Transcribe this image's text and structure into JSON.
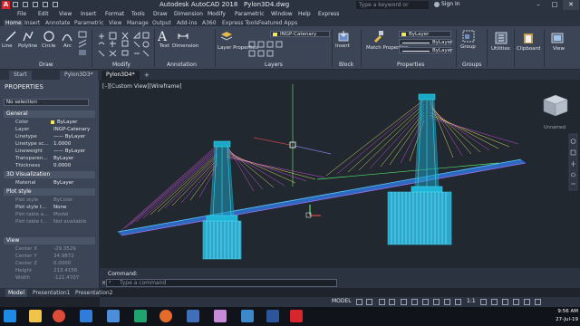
{
  "window": {
    "app_title": "Autodesk AutoCAD 2018",
    "file_name": "Pylon3D4.dwg",
    "search_placeholder": "Type a keyword or phrase",
    "sign_in": "Sign In",
    "minimize": "–",
    "maximize": "□",
    "close": "✕"
  },
  "menu": [
    "File",
    "Edit",
    "View",
    "Insert",
    "Format",
    "Tools",
    "Draw",
    "Dimension",
    "Modify",
    "Parametric",
    "Window",
    "Help",
    "Express"
  ],
  "ribbon_tabs": [
    "Home",
    "Insert",
    "Annotate",
    "Parametric",
    "View",
    "Manage",
    "Output",
    "Add-ins",
    "A360",
    "Express Tools",
    "Featured Apps"
  ],
  "ribbon": {
    "draw": {
      "line": "Line",
      "polyline": "Polyline",
      "circle": "Circle",
      "arc": "Arc",
      "panel": "Draw"
    },
    "modify": {
      "panel": "Modify"
    },
    "annotation": {
      "text": "Text",
      "dimension": "Dimension",
      "panel": "Annotation"
    },
    "layers": {
      "layer_properties": "Layer Properties",
      "current_layer": "INGP-Catenary",
      "panel": "Layers"
    },
    "block": {
      "insert": "Insert",
      "panel": "Block"
    },
    "properties": {
      "match": "Match Properties",
      "color": "ByLayer",
      "linetype": "ByLayer",
      "lineweight": "ByLayer",
      "panel": "Properties"
    },
    "groups": {
      "group": "Group",
      "panel": "Groups"
    },
    "utilities": "Utilities",
    "clipboard": "Clipboard",
    "view": "View"
  },
  "doc_tabs": [
    "Start",
    "Pylon3D3*",
    "Pylon3D4*"
  ],
  "viewport_label": "[–][Custom View][Wireframe]",
  "viewcube_label": "Unnamed",
  "properties": {
    "title": "PROPERTIES",
    "selection": "No selection",
    "general": {
      "title": "General",
      "rows": [
        {
          "k": "Color",
          "v": "ByLayer"
        },
        {
          "k": "Layer",
          "v": "INGP-Catenary"
        },
        {
          "k": "Linetype",
          "v": "—— ByLayer"
        },
        {
          "k": "Linetype sc...",
          "v": "1.0000"
        },
        {
          "k": "Lineweight",
          "v": "—— ByLayer"
        },
        {
          "k": "Transparen...",
          "v": "ByLayer"
        },
        {
          "k": "Thickness",
          "v": "0.0000"
        }
      ]
    },
    "viz": {
      "title": "3D Visualization",
      "rows": [
        {
          "k": "Material",
          "v": "ByLayer"
        }
      ]
    },
    "plot": {
      "title": "Plot style",
      "rows": [
        {
          "k": "Plot style",
          "v": "ByColor"
        },
        {
          "k": "Plot style t...",
          "v": "None"
        },
        {
          "k": "Plot table a...",
          "v": "Model"
        },
        {
          "k": "Plot table t...",
          "v": "Not available"
        }
      ]
    },
    "view": {
      "title": "View",
      "rows": [
        {
          "k": "Center X",
          "v": "-29.3529"
        },
        {
          "k": "Center Y",
          "v": "34.9872"
        },
        {
          "k": "Center Z",
          "v": "0.0000"
        },
        {
          "k": "Height",
          "v": "213.4156"
        },
        {
          "k": "Width",
          "v": "-121.4707"
        }
      ]
    }
  },
  "model_tabs": [
    "Model",
    "Presentation1",
    "Presentation2"
  ],
  "command": {
    "label": "Command:",
    "placeholder": "Type a command"
  },
  "status": {
    "model": "MODEL",
    "scale": "1:1"
  },
  "clock": {
    "time": "9:56 AM",
    "date": "27-Jul-19"
  },
  "colors": {
    "accent": "#ff3b30",
    "pylon": "#38d6f0",
    "deck": "#3fa5ff",
    "cable_yellow": "#f5ee6a",
    "cable_magenta": "#e050e8"
  }
}
